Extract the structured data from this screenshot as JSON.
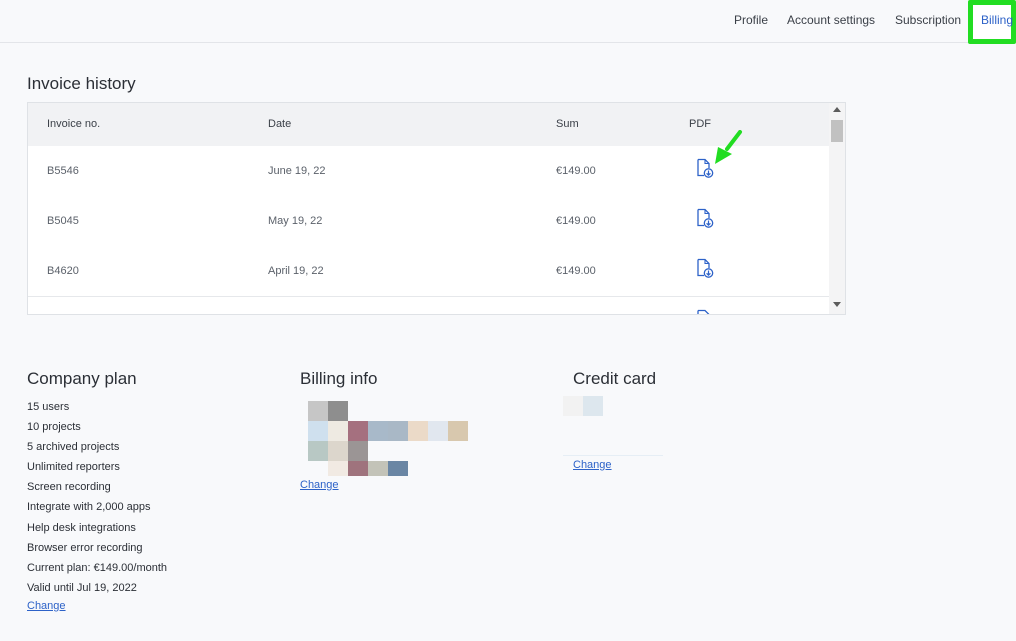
{
  "nav": {
    "items": [
      {
        "label": "Profile"
      },
      {
        "label": "Account settings"
      },
      {
        "label": "Subscription"
      },
      {
        "label": "Billing",
        "active": true
      }
    ]
  },
  "invoice_history": {
    "title": "Invoice history",
    "columns": [
      "Invoice no.",
      "Date",
      "Sum",
      "PDF"
    ],
    "rows": [
      {
        "no": "B5546",
        "date": "June 19, 22",
        "sum": "€149.00",
        "pdf_icon": "file-download-icon"
      },
      {
        "no": "B5045",
        "date": "May 19, 22",
        "sum": "€149.00",
        "pdf_icon": "file-download-icon"
      },
      {
        "no": "B4620",
        "date": "April 19, 22",
        "sum": "€149.00",
        "pdf_icon": "file-download-icon"
      }
    ]
  },
  "company_plan": {
    "title": "Company plan",
    "lines": [
      "15 users",
      "10 projects",
      "5 archived projects",
      "Unlimited reporters",
      "Screen recording",
      "Integrate with 2,000 apps",
      "Help desk integrations",
      "Browser error recording",
      "Current plan: €149.00/month",
      "Valid until Jul 19, 2022"
    ],
    "change_label": "Change"
  },
  "billing_info": {
    "title": "Billing info",
    "change_label": "Change"
  },
  "credit_card": {
    "title": "Credit card",
    "change_label": "Change"
  },
  "colors": {
    "accent": "#2d62c8",
    "highlight": "#22dd22",
    "annotation_arrow": "#22dd22"
  }
}
